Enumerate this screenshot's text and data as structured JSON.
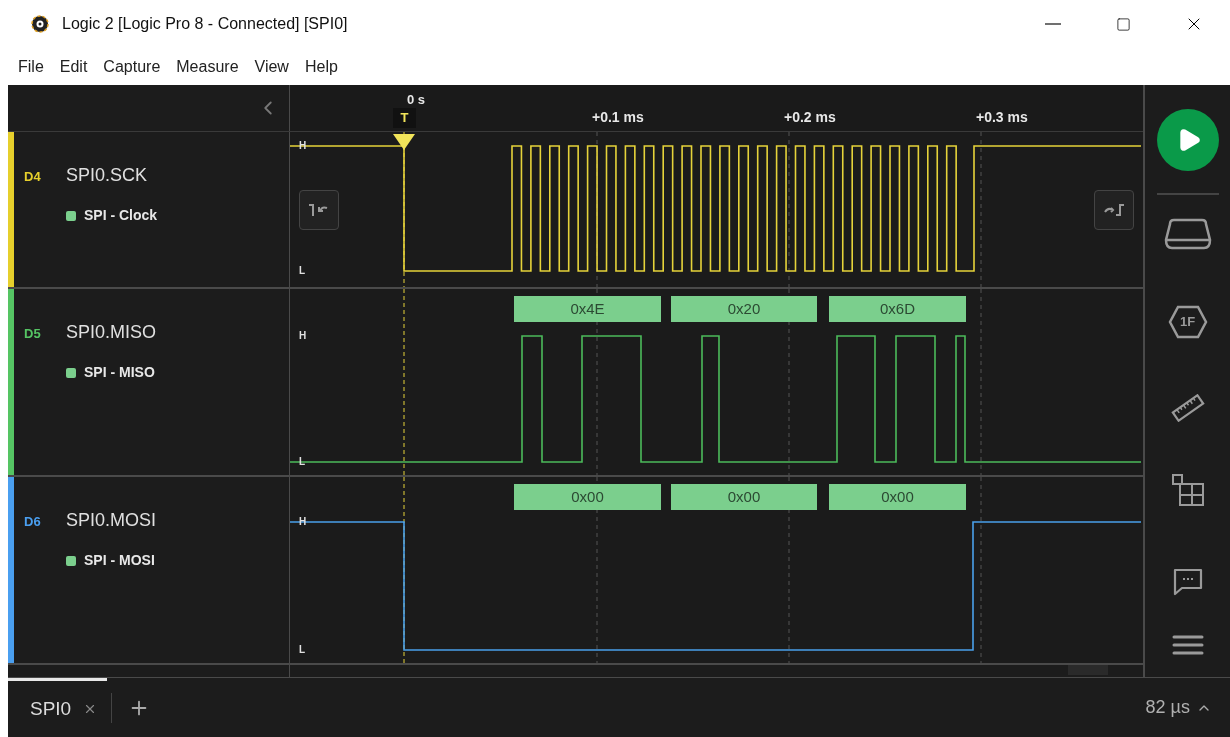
{
  "window": {
    "title": "Logic 2 [Logic Pro 8 - Connected] [SPI0]"
  },
  "menu": [
    "File",
    "Edit",
    "Capture",
    "Measure",
    "View",
    "Help"
  ],
  "ruler": {
    "trigger_time": "0 s",
    "trigger_label": "T",
    "ticks": [
      "+0.1 ms",
      "+0.2 ms",
      "+0.3 ms"
    ]
  },
  "channels": [
    {
      "id": "D4",
      "name": "SPI0.SCK",
      "color": "#e6cf2c",
      "analyzer": "SPI - Clock",
      "high": "H",
      "low": "L",
      "edge_buttons": true
    },
    {
      "id": "D5",
      "name": "SPI0.MISO",
      "color": "#55c463",
      "analyzer": "SPI - MISO",
      "high": "H",
      "low": "L",
      "edge_buttons": false,
      "bytes": [
        "0x4E",
        "0x20",
        "0x6D"
      ]
    },
    {
      "id": "D6",
      "name": "SPI0.MOSI",
      "color": "#4a9ff0",
      "analyzer": "SPI - MOSI",
      "high": "H",
      "low": "L",
      "edge_buttons": false,
      "bytes": [
        "0x00",
        "0x00",
        "0x00"
      ]
    }
  ],
  "tools": [
    {
      "kind": "device"
    },
    {
      "kind": "analyzer",
      "label": "1F"
    },
    {
      "kind": "measure"
    },
    {
      "kind": "extensions"
    },
    {
      "kind": "feedback"
    },
    {
      "kind": "menu"
    }
  ],
  "tabs": [
    {
      "label": "SPI0",
      "selected": true
    }
  ],
  "status": {
    "duration": "82 µs"
  }
}
